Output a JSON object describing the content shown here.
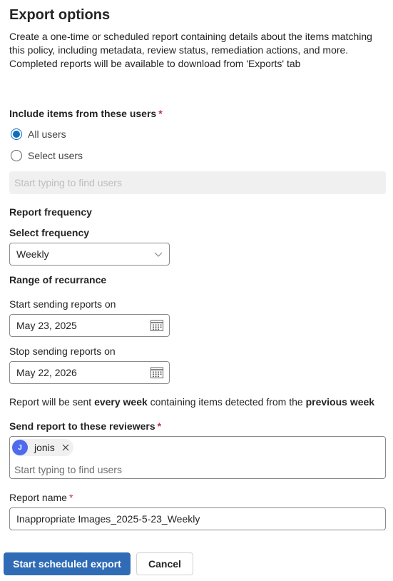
{
  "panel": {
    "title": "Export options",
    "description": "Create a one-time or scheduled report containing details about the items matching this policy, including metadata, review status, remediation actions, and more. Completed reports will be available to download from 'Exports' tab"
  },
  "include_users": {
    "label": "Include items from these users",
    "required_mark": "*",
    "options": [
      {
        "label": "All users",
        "checked": true
      },
      {
        "label": "Select users",
        "checked": false
      }
    ],
    "search_placeholder": "Start typing to find users"
  },
  "frequency": {
    "heading": "Report frequency",
    "select_label": "Select frequency",
    "selected": "Weekly"
  },
  "range": {
    "heading": "Range of recurrance",
    "start_label": "Start sending reports on",
    "start_date": "May 23, 2025",
    "stop_label": "Stop sending reports on",
    "stop_date": "May 22, 2026"
  },
  "info": {
    "part1": "Report will be sent ",
    "bold1": "every week",
    "part2": " containing items detected from the ",
    "bold2": "previous week"
  },
  "reviewers": {
    "label": "Send report to these reviewers",
    "required_mark": "*",
    "chips": [
      {
        "initial": "J",
        "name": "jonis",
        "avatar_color": "#4f6bed"
      }
    ],
    "placeholder": "Start typing to find users"
  },
  "report_name": {
    "label": "Report name",
    "required_mark": "*",
    "value": "Inappropriate Images_2025-5-23_Weekly"
  },
  "actions": {
    "primary": "Start scheduled export",
    "secondary": "Cancel"
  },
  "colors": {
    "primary": "#2f6cb5",
    "radio_accent": "#0f6cbd",
    "required": "#c4314b"
  }
}
